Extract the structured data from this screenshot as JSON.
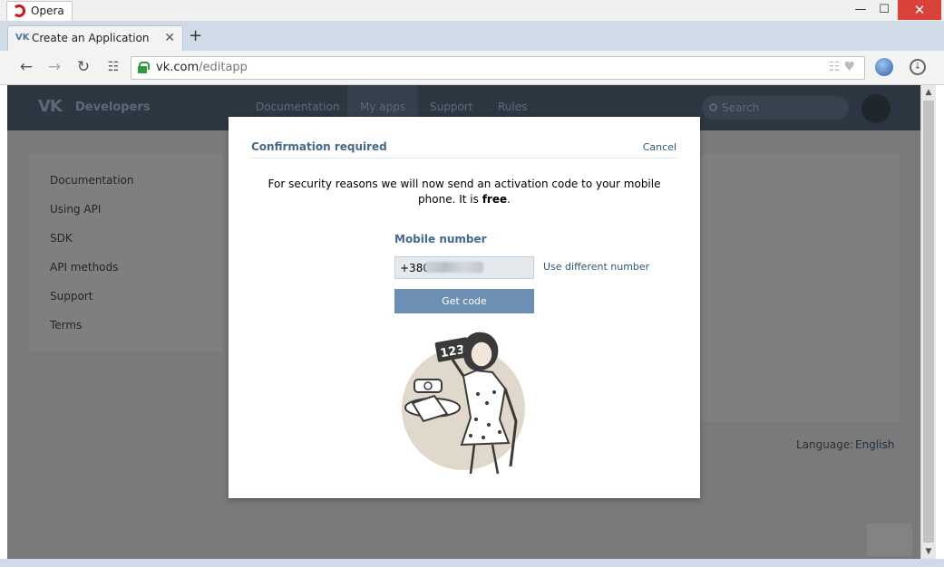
{
  "window": {
    "app_name": "Opera",
    "min_glyph": "—",
    "max_glyph": "☐",
    "close_glyph": "✕"
  },
  "tab": {
    "favicon_text": "VK",
    "title": "Create an Application",
    "close_glyph": "✕",
    "new_tab_glyph": "+"
  },
  "toolbar": {
    "back_glyph": "←",
    "forward_glyph": "→",
    "reload_glyph": "↻",
    "speed_dial_glyph": "☷",
    "url_host": "vk.com",
    "url_path": "/editapp",
    "bookmark_glyphs": "☷♥",
    "download_glyph": "↓"
  },
  "vk_page": {
    "logo": "VK",
    "brand": "Developers",
    "nav": [
      "Documentation",
      "My apps",
      "Support",
      "Rules"
    ],
    "search_placeholder": "Search",
    "side_menu": [
      "Documentation",
      "Using API",
      "SDK",
      "API methods",
      "Support",
      "Terms"
    ],
    "language_label": "Language:",
    "language_value": "English"
  },
  "modal": {
    "title": "Confirmation required",
    "cancel": "Cancel",
    "message_before": "For security reasons we will now send an activation code to your mobile phone. It is ",
    "message_bold": "free",
    "message_after": ".",
    "field_label": "Mobile number",
    "phone_value": "+380",
    "use_different": "Use different number",
    "get_code": "Get code",
    "illustration_sign": "1234"
  },
  "scrollbar": {
    "up_glyph": "▲",
    "down_glyph": "▼"
  },
  "colors": {
    "vk_blue": "#45688e",
    "button": "#6d8fb3",
    "link": "#2b587a",
    "close_red": "#d9433a"
  }
}
